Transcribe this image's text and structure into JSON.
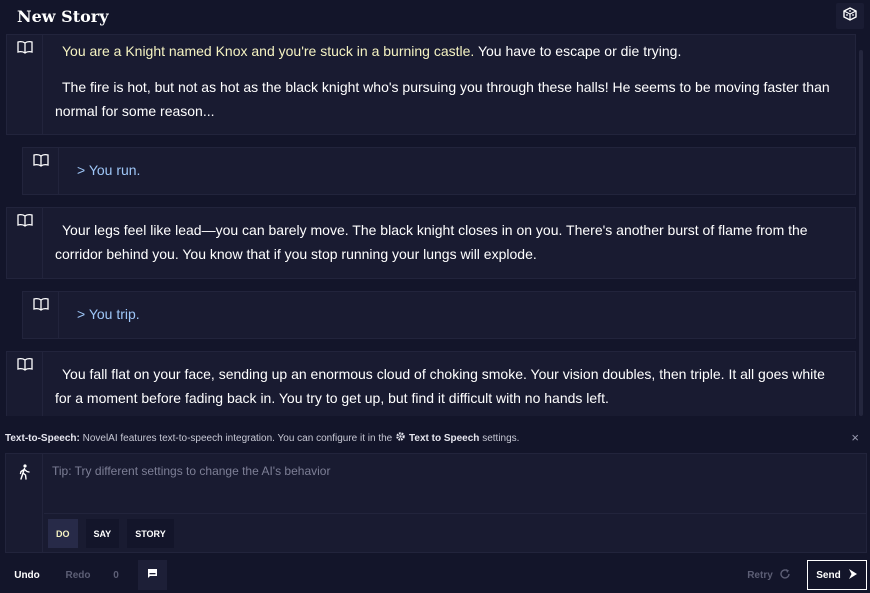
{
  "header": {
    "title": "New Story"
  },
  "story": {
    "intro": {
      "highlight": "You are a Knight named Knox and you're stuck in a burning castle.",
      "rest": " You have to escape or die trying.",
      "para2": "The fire is hot, but not as hot as the black knight who's pursuing you through these halls! He seems to be moving faster than normal for some reason..."
    },
    "action1": "> You run.",
    "response1": "Your legs feel like lead—you can barely move. The black knight closes in on you. There's another burst of flame from the corridor behind you. You know that if you stop running your lungs will explode.",
    "action2": "> You trip.",
    "response2": "You fall flat on your face, sending up an enormous cloud of choking smoke. Your vision doubles, then triple. It all goes white for a moment before fading back in. You try to get up, but find it difficult with no hands left."
  },
  "tts_notice": {
    "label": "Text-to-Speech:",
    "message": " NovelAI features text-to-speech integration. You can configure it in the ",
    "link": "Text to Speech",
    "suffix": " settings.",
    "close": "×"
  },
  "input": {
    "placeholder": "Tip: Try different settings to change the AI's behavior",
    "modes": [
      "DO",
      "SAY",
      "STORY"
    ],
    "active_mode": "DO"
  },
  "controls": {
    "undo": "Undo",
    "redo": "Redo",
    "redo_count": "0",
    "retry": "Retry",
    "send": "Send"
  },
  "colors": {
    "background": "#13152a",
    "panel": "#191b31",
    "highlight_text": "#f5f3c2",
    "action_text": "#9ec6f7"
  },
  "icons": {
    "header": "dice-icon",
    "block": "book-icon",
    "input": "walking-person-icon",
    "tts_link": "gear-icon",
    "comment": "comment-icon",
    "retry": "refresh-icon",
    "send": "chevron-right-icon"
  }
}
